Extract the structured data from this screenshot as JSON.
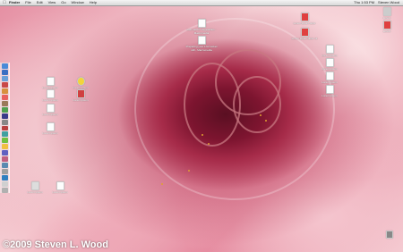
{
  "menubar": {
    "apple": "",
    "menus": [
      "Finder",
      "File",
      "Edit",
      "View",
      "Go",
      "Window",
      "Help"
    ],
    "clock": "Thu 1:53 PM",
    "user": "Steven Wood"
  },
  "dock": {
    "icons": [
      "finder-icon",
      "browser-icon",
      "mail-icon",
      "itunes-icon",
      "photo-icon",
      "calendar-icon",
      "address-icon",
      "app-icon",
      "app-icon",
      "app-icon",
      "app-icon",
      "app-icon",
      "app-icon",
      "app-icon",
      "app-icon",
      "app-icon",
      "app-icon",
      "app-icon",
      "app-icon",
      "app-icon",
      "trash-icon"
    ]
  },
  "desktop_icons": {
    "left": [
      {
        "label": "Lorem ipsum"
      },
      {
        "label": "Lorem ipsum"
      },
      {
        "label": "Lorem ipsum"
      },
      {
        "label": "Lorem ipsum"
      },
      {
        "label": "Lorem ipsum"
      },
      {
        "label": "Lorem ipsum"
      },
      {
        "label": "Lorem ipsum"
      },
      {
        "label": "Lorem ipsum"
      }
    ],
    "center": [
      {
        "label": "Last call for Vegetables - Macromedia"
      },
      {
        "label": "Preparing your Lost sweet still - Macromedia"
      }
    ],
    "right": [
      {
        "label": "Lorem ipsum dolor"
      },
      {
        "label": "Lorem ipsum dolor sit"
      },
      {
        "label": "Lorem ipsum"
      },
      {
        "label": "Lorem ipsum"
      },
      {
        "label": "Lorem ipsum"
      },
      {
        "label": "Lorem ipsum"
      },
      {
        "label": "Lorem"
      },
      {
        "label": "Lorem"
      }
    ]
  },
  "watermark": "©2009 Steven L. Wood"
}
